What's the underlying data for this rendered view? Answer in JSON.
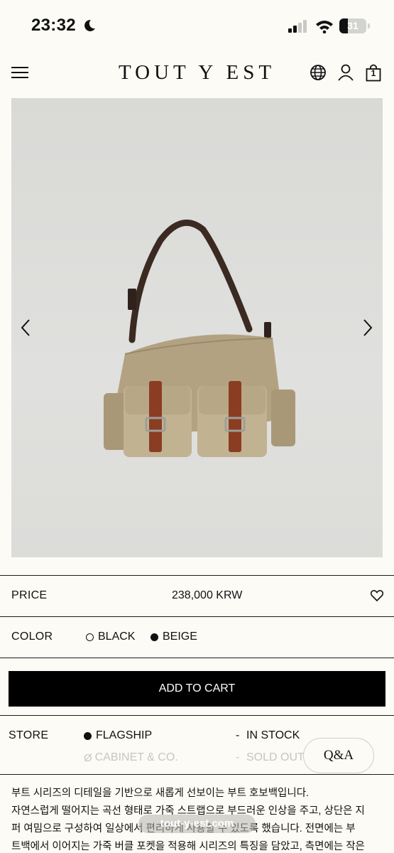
{
  "status_bar": {
    "time": "23:32",
    "battery": "31",
    "battery_level": 0.31
  },
  "header": {
    "logo": "TOUT Y EST",
    "cart_count": "1"
  },
  "product": {
    "price_label": "PRICE",
    "price": "238,000 KRW",
    "color_label": "COLOR",
    "colors": [
      {
        "label": "BLACK",
        "selected": false
      },
      {
        "label": "BEIGE",
        "selected": true
      }
    ],
    "add_to_cart": "ADD TO CART"
  },
  "store": {
    "label": "STORE",
    "rows": [
      {
        "name": "FLAGSHIP",
        "separator": "-",
        "status": "IN STOCK",
        "available": true
      },
      {
        "name": "CABINET & CO.",
        "separator": "-",
        "status": "SOLD OUT",
        "available": false
      }
    ]
  },
  "qa_button": "Q&A",
  "description_lines": [
    "부트 시리즈의 디테일을 기반으로 새롭게 선보이는 부트 호보백입니다.",
    "자연스럽게 떨어지는 곡선 형태로 가죽 스트랩으로 부드러운 인상을 주고, 상단은 지",
    "퍼 여밈으로 구성하여 일상에서 편리하게 사용할 수 있도록 했습니다. 전면에는 부",
    "트백에서 이어지는 가죽 버클 포켓을 적용해 시리즈의 특징을 담았고, 측면에는 작은"
  ],
  "url_pill": "tout-y-est.com",
  "colors": {
    "background": "#fcfbf5",
    "button": "#000000",
    "muted_text": "#c6c6c2"
  }
}
